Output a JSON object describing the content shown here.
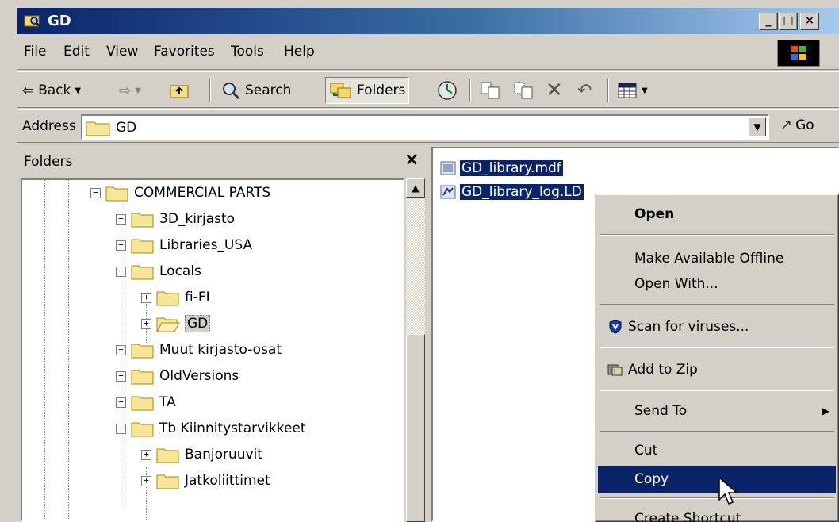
{
  "window": {
    "title": "GD"
  },
  "menubar": {
    "items": [
      "File",
      "Edit",
      "View",
      "Favorites",
      "Tools",
      "Help"
    ]
  },
  "toolbar": {
    "back_label": "Back",
    "search_label": "Search",
    "folders_label": "Folders"
  },
  "address": {
    "label": "Address",
    "value": "GD",
    "go_label": "Go"
  },
  "folders_pane": {
    "title": "Folders",
    "close_label": "×",
    "tree": [
      {
        "label": "COMMERCIAL PARTS",
        "expander": "−"
      },
      {
        "label": "3D_kirjasto",
        "expander": "+"
      },
      {
        "label": "Libraries_USA",
        "expander": "+"
      },
      {
        "label": "Locals",
        "expander": "−"
      },
      {
        "label": "fi-FI",
        "expander": "+"
      },
      {
        "label": "GD",
        "expander": "+"
      },
      {
        "label": "Muut kirjasto-osat",
        "expander": "+"
      },
      {
        "label": "OldVersions",
        "expander": "+"
      },
      {
        "label": "TA",
        "expander": "+"
      },
      {
        "label": "Tb Kiinnitystarvikkeet",
        "expander": "−"
      },
      {
        "label": "Banjoruuvit",
        "expander": "+"
      },
      {
        "label": "Jatkoliittimet",
        "expander": "+"
      }
    ]
  },
  "files": [
    {
      "name": "GD_library.mdf"
    },
    {
      "name": "GD_library_log.LD"
    }
  ],
  "context_menu": {
    "items": [
      {
        "label": "Open"
      },
      {
        "label": "Make Available Offline"
      },
      {
        "label": "Open With..."
      },
      {
        "label": "Scan for viruses..."
      },
      {
        "label": "Add to Zip"
      },
      {
        "label": "Send To"
      },
      {
        "label": "Cut"
      },
      {
        "label": "Copy"
      },
      {
        "label": "Create Shortcut"
      }
    ]
  },
  "colors": {
    "selection": "#0a246a",
    "face": "#d4d0c8"
  }
}
